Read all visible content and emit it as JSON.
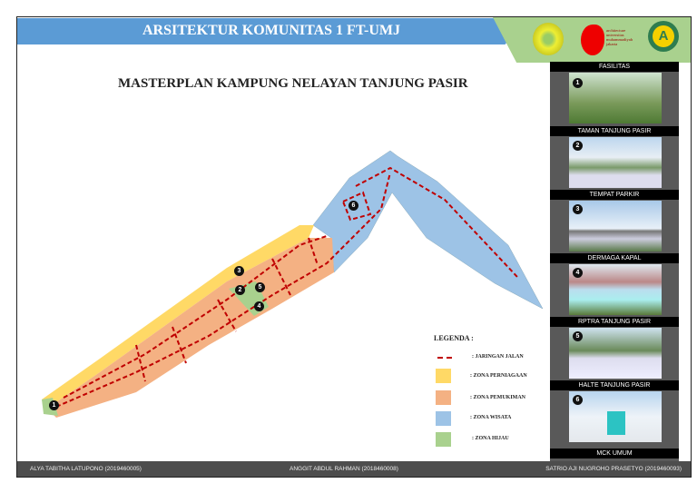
{
  "header": {
    "title": "ARSITEKTUR KOMUNITAS 1 FT-UMJ",
    "logo_text": "architecture universitas muhammadiyah jakarta",
    "badge": "A"
  },
  "main_title": "MASTERPLAN KAMPUNG NELAYAN TANJUNG PASIR",
  "facilities": {
    "heading": "FASILITAS",
    "items": [
      {
        "num": "1",
        "label": "TAMAN TANJUNG PASIR"
      },
      {
        "num": "2",
        "label": "TEMPAT PARKIR"
      },
      {
        "num": "3",
        "label": "DERMAGA  KAPAL"
      },
      {
        "num": "4",
        "label": "RPTRA TANJUNG PASIR"
      },
      {
        "num": "5",
        "label": "HALTE TANJUNG PASIR"
      },
      {
        "num": "6",
        "label": "MCK UMUM"
      }
    ]
  },
  "map_markers": [
    "1",
    "2",
    "3",
    "4",
    "5",
    "6"
  ],
  "legend": {
    "title": "LEGENDA :",
    "items": [
      {
        "label": ": JARINGAN JALAN",
        "color": "#c00000"
      },
      {
        "label": ": ZONA PERNIAGAAN",
        "color": "#ffd966"
      },
      {
        "label": ": ZONA PEMUKIMAN",
        "color": "#f4b183"
      },
      {
        "label": ": ZONA WISATA",
        "color": "#9dc3e6"
      },
      {
        "label": ": ZONA HIJAU",
        "color": "#a9d18e"
      }
    ]
  },
  "footer": {
    "authors": [
      "ALYA TABITHA LATUPONO (2019460005)",
      "ANGGIT ABDUL RAHMAN (2018460008)",
      "SATRIO AJI NUGROHO PRASETYO (2019460093)"
    ]
  }
}
